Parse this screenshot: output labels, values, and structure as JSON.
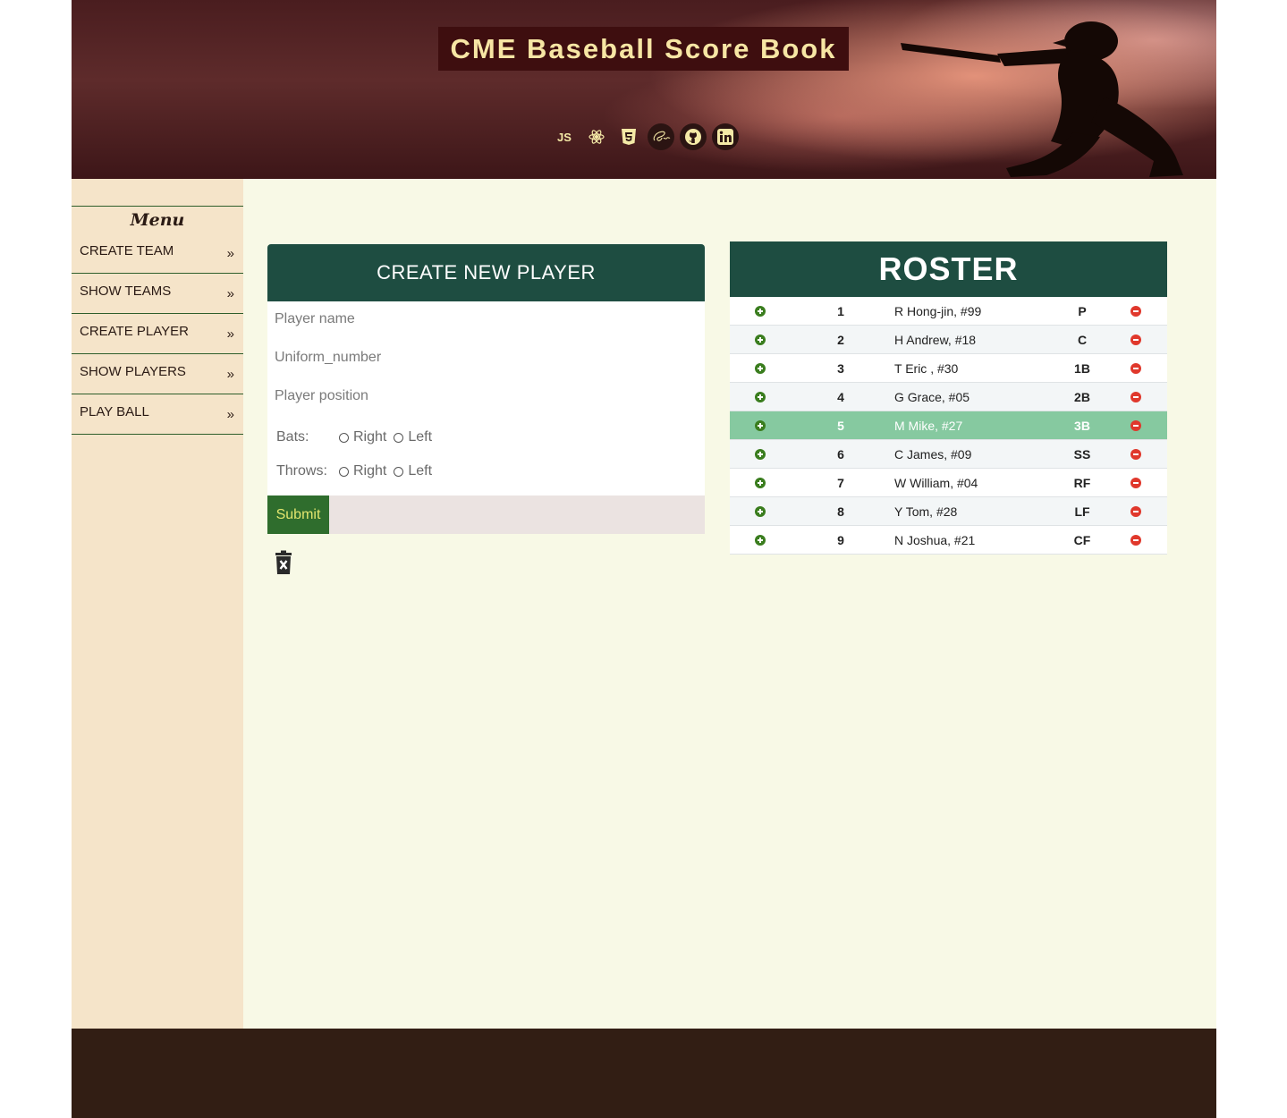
{
  "header": {
    "title": "CME Baseball Score Book",
    "tech_icons": [
      {
        "name": "javascript-icon",
        "text": "JS"
      },
      {
        "name": "react-icon"
      },
      {
        "name": "html5-icon"
      },
      {
        "name": "sass-icon"
      },
      {
        "name": "github-icon"
      },
      {
        "name": "linkedin-icon"
      }
    ]
  },
  "sidebar": {
    "title": "Menu",
    "items": [
      {
        "label": "CREATE TEAM",
        "arrow": "»"
      },
      {
        "label": "SHOW TEAMS",
        "arrow": "»"
      },
      {
        "label": "CREATE PLAYER",
        "arrow": "»"
      },
      {
        "label": "SHOW PLAYERS",
        "arrow": "»"
      },
      {
        "label": "PLAY BALL",
        "arrow": "»"
      }
    ]
  },
  "form": {
    "title": "CREATE NEW PLAYER",
    "name_placeholder": "Player name",
    "uniform_placeholder": "Uniform_number",
    "position_placeholder": "Player position",
    "bats_label": "Bats:",
    "throws_label": "Throws:",
    "right_label": "Right",
    "left_label": "Left",
    "submit_label": "Submit"
  },
  "roster": {
    "title": "ROSTER",
    "players": [
      {
        "order": "1",
        "name": "R Hong-jin, #99",
        "position": "P"
      },
      {
        "order": "2",
        "name": "H Andrew, #18",
        "position": "C"
      },
      {
        "order": "3",
        "name": "T Eric , #30",
        "position": "1B"
      },
      {
        "order": "4",
        "name": "G Grace, #05",
        "position": "2B"
      },
      {
        "order": "5",
        "name": "M Mike, #27",
        "position": "3B"
      },
      {
        "order": "6",
        "name": "C James, #09",
        "position": "SS"
      },
      {
        "order": "7",
        "name": "W William, #04",
        "position": "RF"
      },
      {
        "order": "8",
        "name": "Y Tom, #28",
        "position": "LF"
      },
      {
        "order": "9",
        "name": "N Joshua, #21",
        "position": "CF"
      }
    ],
    "active_order": "5"
  },
  "colors": {
    "header_green": "#1e4d41",
    "sidebar_bg": "#f5e4c9",
    "main_bg": "#f8f9e6",
    "footer_bg": "#321e14",
    "active_row": "#86c9a0",
    "add_icon": "#3a7d1e",
    "remove_icon": "#e0382c"
  }
}
